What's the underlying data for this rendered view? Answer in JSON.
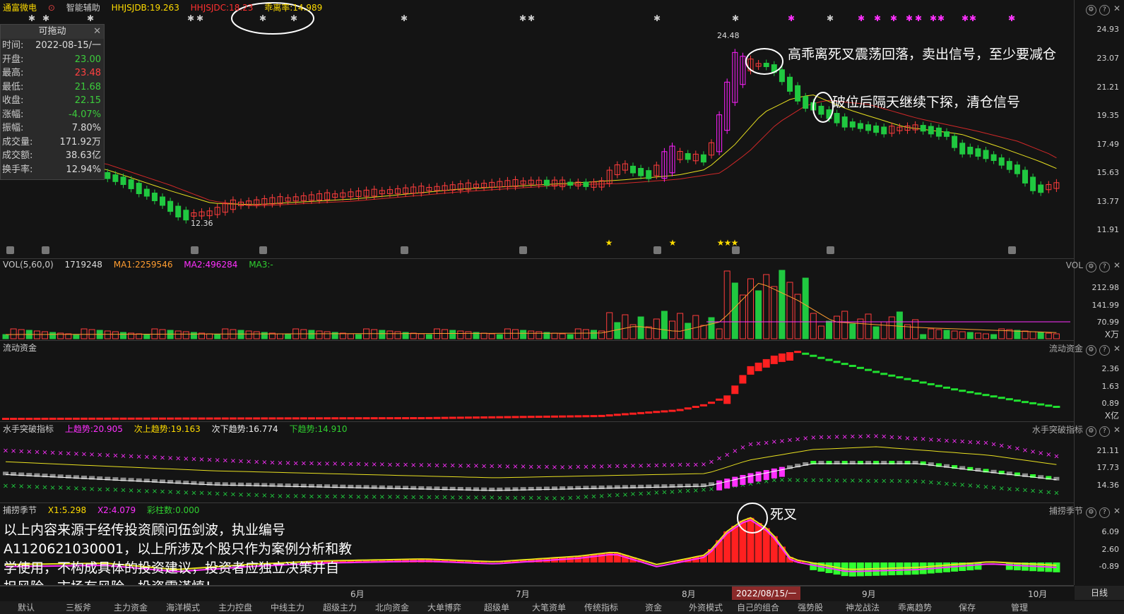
{
  "top": {
    "stock_name": "通富微电",
    "assist": "智能辅助",
    "hhjsjdb": "HHJSJDB:19.263",
    "hhjsjdc": "HHJSJDC:18.23",
    "deviation": "乖离率:14.989"
  },
  "info": {
    "title": "可拖动",
    "rows": [
      {
        "k": "时间:",
        "v": "2022-08-15/一",
        "c": "#dcdcdc"
      },
      {
        "k": "开盘:",
        "v": "23.00",
        "c": "#3ccc3c"
      },
      {
        "k": "最高:",
        "v": "23.48",
        "c": "#ff4040"
      },
      {
        "k": "最低:",
        "v": "21.68",
        "c": "#3ccc3c"
      },
      {
        "k": "收盘:",
        "v": "22.15",
        "c": "#3ccc3c"
      },
      {
        "k": "涨幅:",
        "v": "-4.07%",
        "c": "#3ccc3c"
      },
      {
        "k": "振幅:",
        "v": "7.80%",
        "c": "#dcdcdc"
      },
      {
        "k": "成交量:",
        "v": "171.92万",
        "c": "#dcdcdc"
      },
      {
        "k": "成交额:",
        "v": "38.63亿",
        "c": "#dcdcdc"
      },
      {
        "k": "换手率:",
        "v": "12.94%",
        "c": "#dcdcdc"
      }
    ]
  },
  "price_axis": [
    "24.93",
    "23.07",
    "21.21",
    "19.35",
    "17.49",
    "15.63",
    "13.77",
    "11.91"
  ],
  "price_labels": {
    "high": "24.48",
    "low": "12.36"
  },
  "annotations": {
    "sell": "高乖离死叉震荡回落，卖出信号，至少要减仓",
    "clear": "破位后隔天继续下探，清仓信号",
    "death_cross": "死叉",
    "disclaimer": [
      "以上内容来源于经传投资顾问伍剑波，执业编号",
      "A1120621030001，以上所涉及个股只作为案例分析和教",
      "学使用，不构成具体的投资建议，投资者应独立决策并自",
      "担风险，市场有风险，投资需谨慎！"
    ]
  },
  "vol": {
    "label": "VOL(5,60,0)",
    "value": "1719248",
    "ma1": "MA1:2259546",
    "ma2": "MA2:496284",
    "ma3": "MA3:-",
    "name": "VOL",
    "axis": [
      "212.98",
      "141.99",
      "70.99",
      "X万"
    ]
  },
  "flow": {
    "label": "流动资金",
    "name": "流动资金",
    "axis": [
      "2.36",
      "1.63",
      "0.89",
      "X亿"
    ]
  },
  "sailor": {
    "label": "水手突破指标",
    "up": "上趋势:20.905",
    "up2": "次上趋势:19.163",
    "down2": "次下趋势:16.774",
    "down": "下趋势:14.910",
    "name": "水手突破指标",
    "axis": [
      "21.11",
      "17.73",
      "14.36"
    ]
  },
  "season": {
    "label": "捕捞季节",
    "x1": "X1:5.298",
    "x2": "X2:4.079",
    "bars": "彩柱数:0.000",
    "name": "捕捞季节",
    "axis": [
      "6.09",
      "2.60",
      "-0.89"
    ]
  },
  "months": [
    "6月",
    "7月",
    "8月",
    "2022/08/15/一",
    "9月",
    "10月"
  ],
  "period": "日线",
  "bottom_tabs": [
    "默认",
    "三板斧",
    "主力资金",
    "海洋模式",
    "主力控盘",
    "中线主力",
    "超级主力",
    "北向资金",
    "大单博弈",
    "超级单",
    "大笔资单",
    "传统指标",
    "资金",
    "外资模式",
    "自己的组合",
    "强势股",
    "神龙战法",
    "乖离趋势",
    "保存",
    "管理"
  ]
}
